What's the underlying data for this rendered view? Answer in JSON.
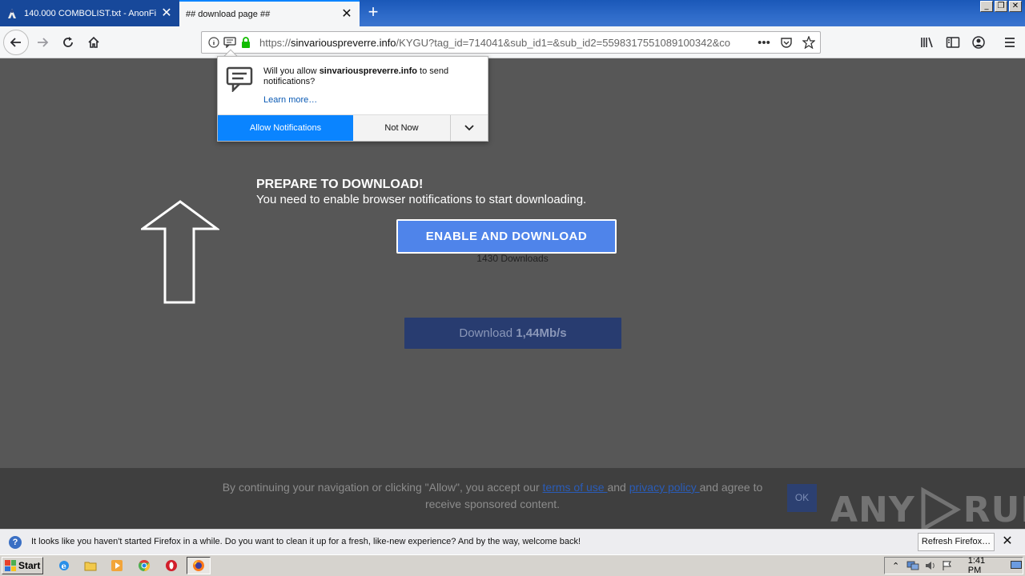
{
  "browser": {
    "tabs": [
      {
        "title": "140.000 COMBOLIST.txt - AnonFi",
        "close": "✕"
      },
      {
        "title": "## download page ##",
        "close": "✕"
      }
    ],
    "new_tab": "+",
    "url_scheme": "https://",
    "url_host": "sinvariouspreverre.info",
    "url_path": "/KYGU?tag_id=714041&sub_id1=&sub_id2=5598317551089100342&co",
    "window_buttons": [
      "_",
      "❐",
      "✕"
    ]
  },
  "notification": {
    "prefix": "Will you allow ",
    "site": "sinvariouspreverre.info",
    "suffix": " to send notifications?",
    "learn_more": "Learn more…",
    "allow_label": "Allow Notifications",
    "not_now_label": "Not Now"
  },
  "page": {
    "heading": "PREPARE TO DOWNLOAD!",
    "subheading": "You need to enable browser notifications to start downloading.",
    "enable_button": "ENABLE AND DOWNLOAD",
    "download_count": "1430 Downloads",
    "download_label": "Download ",
    "download_speed": "1,44Mb/s"
  },
  "cookie": {
    "text_a": "By continuing your navigation or clicking \"Allow\", you accept our ",
    "terms": "terms of use ",
    "and": "and ",
    "privacy": "privacy policy ",
    "text_b": "and agree to receive sponsored content.",
    "ok": "OK"
  },
  "watermark": {
    "left": "ANY",
    "right": "RUN"
  },
  "refresh": {
    "message": "It looks like you haven't started Firefox in a while. Do you want to clean it up for a fresh, like-new experience? And by the way, welcome back!",
    "button": "Refresh Firefox…",
    "close": "✕"
  },
  "taskbar": {
    "start": "Start",
    "clock": "1:41 PM"
  }
}
